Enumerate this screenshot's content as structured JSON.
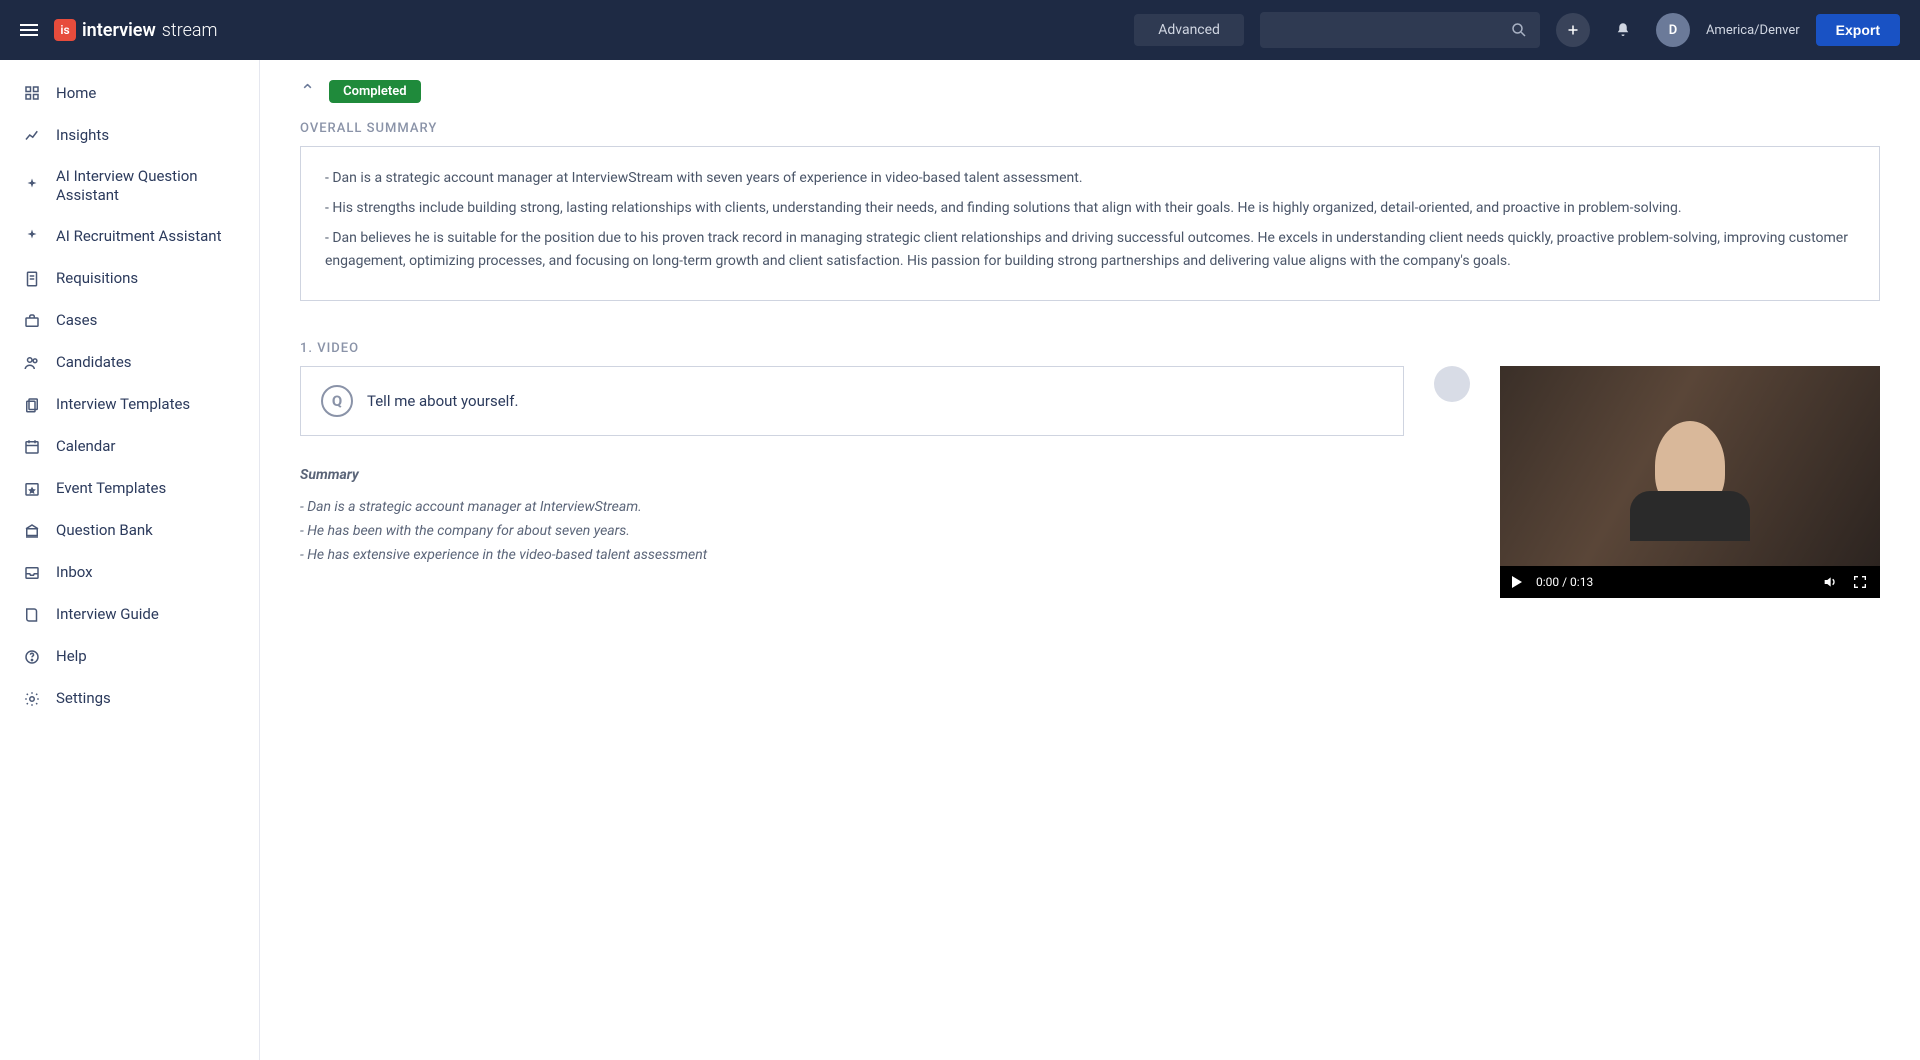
{
  "brand": {
    "name_bold": "interview",
    "name_thin": "stream"
  },
  "header": {
    "tab": "Advanced",
    "timezone": "America/Denver",
    "avatar_initial": "D",
    "export_label": "Export",
    "search_placeholder": ""
  },
  "sidebar": {
    "items": [
      {
        "label": "Home"
      },
      {
        "label": "Insights"
      },
      {
        "label": "AI Interview Question Assistant"
      },
      {
        "label": "AI Recruitment Assistant"
      },
      {
        "label": "Requisitions"
      },
      {
        "label": "Cases"
      },
      {
        "label": "Candidates"
      },
      {
        "label": "Interview Templates"
      },
      {
        "label": "Calendar"
      },
      {
        "label": "Event Templates"
      },
      {
        "label": "Question Bank"
      },
      {
        "label": "Inbox"
      },
      {
        "label": "Interview Guide"
      },
      {
        "label": "Help"
      },
      {
        "label": "Settings"
      }
    ]
  },
  "content": {
    "status_badge": "Completed",
    "overall_label": "OVERALL SUMMARY",
    "summary": {
      "p1": "- Dan is a strategic account manager at InterviewStream with seven years of experience in video-based talent assessment.",
      "p2": "- His strengths include building strong, lasting relationships with clients, understanding their needs, and finding solutions that align with their goals. He is highly organized, detail-oriented, and proactive in problem-solving.",
      "p3": "- Dan believes he is suitable for the position due to his proven track record in managing strategic client relationships and driving successful outcomes. He excels in understanding client needs quickly, proactive problem-solving, improving customer engagement, optimizing processes, and focusing on long-term growth and client satisfaction. His passion for building strong partnerships and delivering value aligns with the company's goals."
    },
    "video_section_label": "1. VIDEO",
    "question_text": "Tell me about yourself.",
    "video_time": "0:00 / 0:13",
    "sub_summary_title": "Summary",
    "sub_summary": {
      "l1": "- Dan is a strategic account manager at InterviewStream.",
      "l2": "- He has been with the company for about seven years.",
      "l3": "- He has extensive experience in the video-based talent assessment"
    }
  }
}
